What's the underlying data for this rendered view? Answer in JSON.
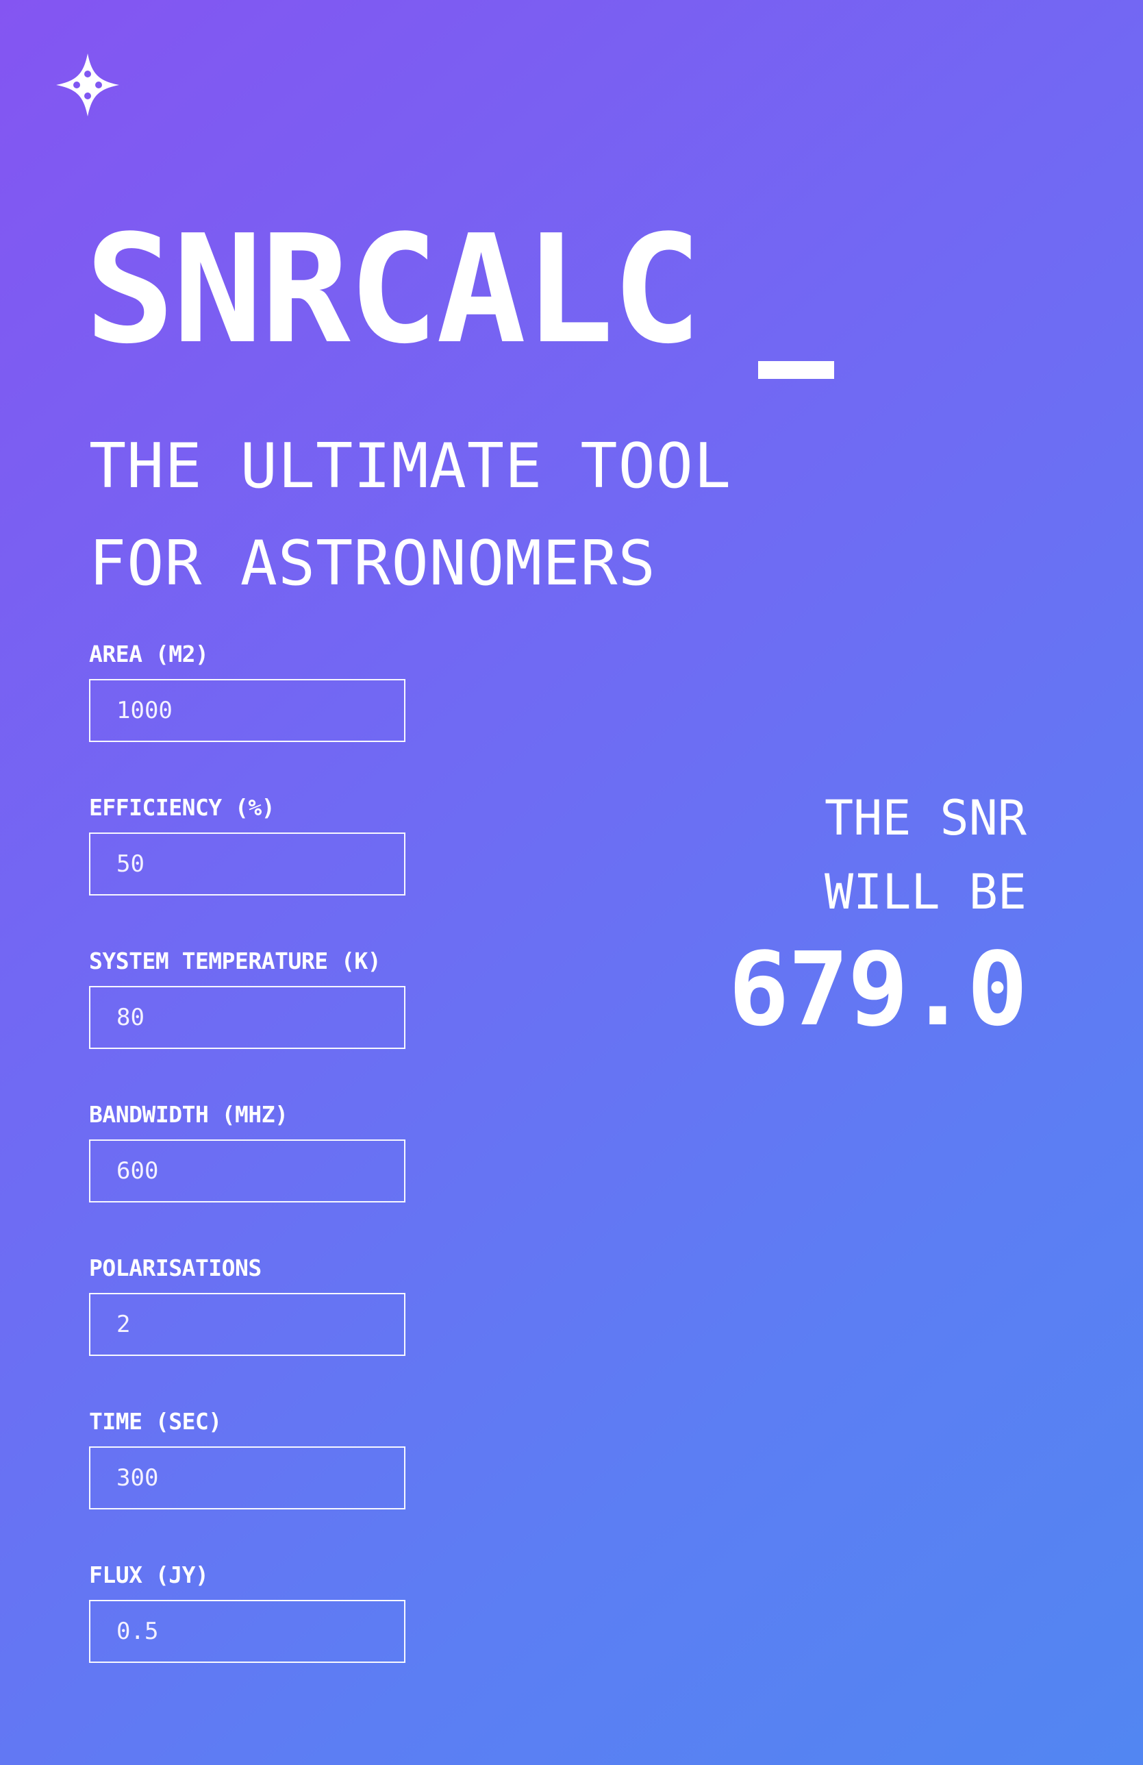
{
  "header": {
    "logo_icon": "sparkle-star-icon",
    "title": "SNRCALC",
    "subtitle_line1": "THE ULTIMATE TOOL",
    "subtitle_line2": "FOR ASTRONOMERS"
  },
  "form": {
    "area": {
      "label": "AREA (M2)",
      "value": "1000"
    },
    "efficiency": {
      "label": "EFFICIENCY (%)",
      "value": "50"
    },
    "system_temperature": {
      "label": "SYSTEM TEMPERATURE (K)",
      "value": "80"
    },
    "bandwidth": {
      "label": "BANDWIDTH (MHZ)",
      "value": "600"
    },
    "polarisations": {
      "label": "POLARISATIONS",
      "value": "2"
    },
    "time": {
      "label": "TIME (SEC)",
      "value": "300"
    },
    "flux": {
      "label": "FLUX (JY)",
      "value": "0.5"
    }
  },
  "result": {
    "line1": "THE SNR",
    "line2": "WILL BE",
    "value": "679.0"
  },
  "colors": {
    "gradient_start": "#8455f2",
    "gradient_end": "#5286f2",
    "foreground": "#ffffff"
  }
}
